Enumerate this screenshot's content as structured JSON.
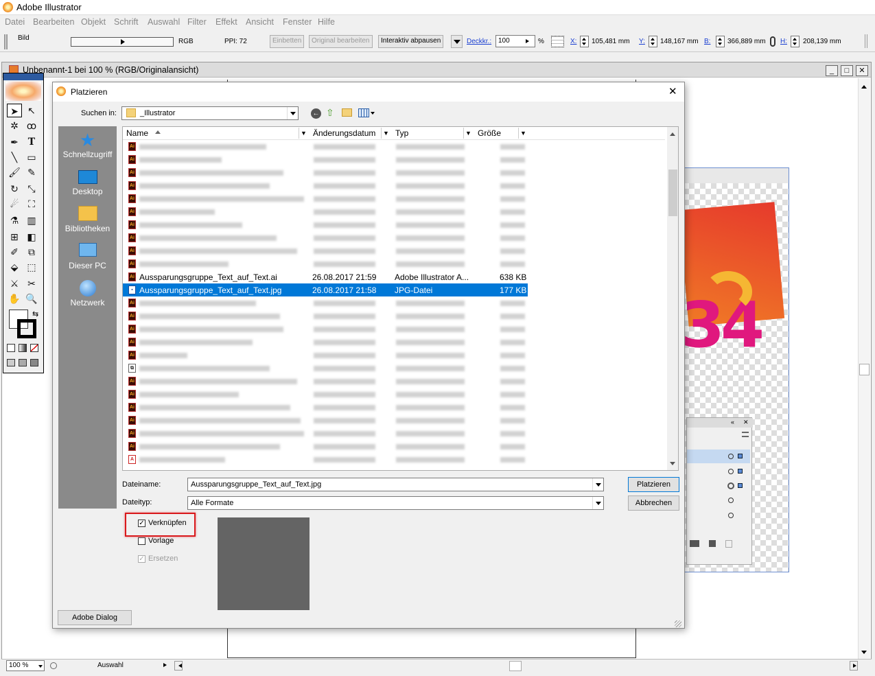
{
  "app": {
    "title": "Adobe Illustrator"
  },
  "menu": [
    "Datei",
    "Bearbeiten",
    "Objekt",
    "Schrift",
    "Auswahl",
    "Filter",
    "Effekt",
    "Ansicht",
    "Fenster",
    "Hilfe"
  ],
  "control": {
    "object_type": "Bild",
    "color_mode": "RGB",
    "ppi": "PPI: 72",
    "embed": "Einbetten",
    "edit_original": "Original bearbeiten",
    "live_trace": "Interaktiv abpausen",
    "opacity_label": "Deckkr.:",
    "opacity_value": "100",
    "opacity_unit": "%",
    "x_label": "X:",
    "x_value": "105,481 mm",
    "y_label": "Y:",
    "y_value": "148,167 mm",
    "w_label": "B:",
    "w_value": "366,889 mm",
    "h_label": "H:",
    "h_value": "208,139 mm"
  },
  "document": {
    "title": "Unbenannt-1 bei 100 % (RGB/Originalansicht)",
    "zoom": "100 %",
    "status": "Auswahl"
  },
  "dialog": {
    "title": "Platzieren",
    "look_in_label": "Suchen in:",
    "look_in_value": "_Illustrator",
    "places": [
      {
        "label": "Schnellzugriff",
        "icon": "star-icon"
      },
      {
        "label": "Desktop",
        "icon": "desktop-icon"
      },
      {
        "label": "Bibliotheken",
        "icon": "folder-icon"
      },
      {
        "label": "Dieser PC",
        "icon": "computer-icon"
      },
      {
        "label": "Netzwerk",
        "icon": "network-icon"
      }
    ],
    "columns": {
      "name": "Name",
      "date": "Änderungsdatum",
      "type": "Typ",
      "size": "Größe"
    },
    "files": [
      {
        "name": "Aussparungsgruppe_Text_auf_Text.ai",
        "date": "26.08.2017 21:59",
        "type": "Adobe Illustrator A...",
        "size": "638 KB"
      },
      {
        "name": "Aussparungsgruppe_Text_auf_Text.jpg",
        "date": "26.08.2017 21:58",
        "type": "JPG-Datei",
        "size": "177 KB"
      }
    ],
    "filename_label": "Dateiname:",
    "filename_value": "Aussparungsgruppe_Text_auf_Text.jpg",
    "filetype_label": "Dateityp:",
    "filetype_value": "Alle Formate",
    "place_button": "Platzieren",
    "cancel_button": "Abbrechen",
    "link_checkbox": "Verknüpfen",
    "template_checkbox": "Vorlage",
    "replace_checkbox": "Ersetzen",
    "adobe_dialog_button": "Adobe Dialog"
  },
  "colors": {
    "selection": "#0078d7",
    "highlight_frame": "#d9191c",
    "places_bar": "#8a8a8a",
    "preview": "#646464"
  }
}
